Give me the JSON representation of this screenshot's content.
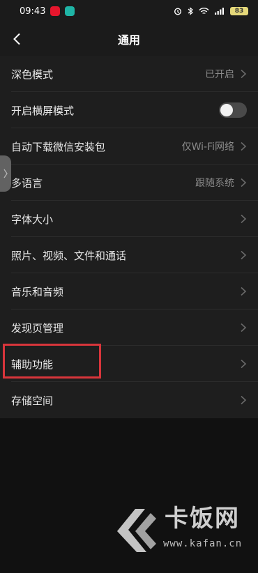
{
  "status_bar": {
    "time": "09:43",
    "battery": "83"
  },
  "nav": {
    "title": "通用"
  },
  "settings": [
    {
      "label": "深色模式",
      "value": "已开启"
    },
    {
      "label": "开启横屏模式",
      "toggle": false
    },
    {
      "label": "自动下载微信安装包",
      "value": "仅Wi-Fi网络"
    },
    {
      "label": "多语言",
      "value": "跟随系统"
    },
    {
      "label": "字体大小",
      "value": ""
    },
    {
      "label": "照片、视频、文件和通话",
      "value": ""
    },
    {
      "label": "音乐和音频",
      "value": ""
    },
    {
      "label": "发现页管理",
      "value": ""
    },
    {
      "label": "辅助功能",
      "value": ""
    },
    {
      "label": "存储空间",
      "value": ""
    }
  ],
  "watermark": {
    "brand": "卡饭网",
    "url": "www.kafan.cn"
  },
  "icons": {
    "back": "chevron-left-icon",
    "chevron": "chevron-right-icon"
  },
  "colors": {
    "background": "#111111",
    "row": "#1e1e1e",
    "highlight": "#d8353b"
  }
}
